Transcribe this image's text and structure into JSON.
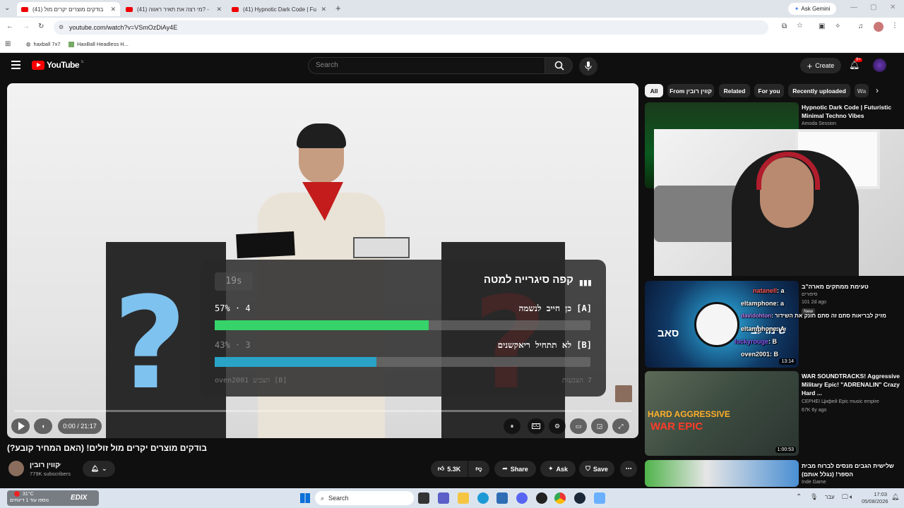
{
  "browser": {
    "tabs": [
      {
        "title": "(41) בודקים מוצרים יקרים מול",
        "active": true
      },
      {
        "title": "(41) מי רצה את תאיר ראווה? -",
        "active": false
      },
      {
        "title": "(41) Hypnotic Dark Code | Futu",
        "active": false
      }
    ],
    "new_tab": "+",
    "ask_gemini": "Ask Gemini",
    "url": "youtube.com/watch?v=VSmOzDiAy4E",
    "bookmarks": [
      "haxball 7x7",
      "HaxBall Headless H..."
    ]
  },
  "youtube": {
    "logo": "YouTube",
    "region": "IL",
    "search_placeholder": "Search",
    "create_label": "Create",
    "notif_count": "9+"
  },
  "video": {
    "poll": {
      "timer": "19s",
      "question": "קפה סיגרייה למטה",
      "options": [
        {
          "label": "[A] כן חייב לנשמה",
          "percent": "57%",
          "votes": "4",
          "fraction": 0.57,
          "color": "#36d36a"
        },
        {
          "label": "[B] לא תתחיל ריאקשנים",
          "percent": "43%",
          "votes": "3",
          "fraction": 0.43,
          "color": "#2aa3c7"
        }
      ],
      "last_vote": "[B] הצביע oven2001",
      "total": "7 הצבעות"
    },
    "time": "0:00 / 21:17",
    "title": "בודקים מוצרים יקרים מול זולים! (האם המחיר קובע?)"
  },
  "channel": {
    "name": "קווין רובין",
    "subscribers": "779K subscribers",
    "likes": "5.3K",
    "share": "Share",
    "ask": "Ask",
    "save": "Save"
  },
  "chips": [
    "All",
    "From קווין רובין",
    "Related",
    "For you",
    "Recently uploaded",
    "Wa"
  ],
  "recommendations": [
    {
      "title": "Hypnotic Dark Code | Futuristic Minimal Techno Vibes",
      "channel": "Amoda Session",
      "meta": ""
    },
    {
      "title": "טעימת ממתקים מארה\"ב",
      "channel": "סיפורים",
      "meta": "101 2d ago",
      "badge": "New"
    },
    {
      "title": "WAR SOUNDTRACKS! Aggressive Military Epic! \"ADRENALIN\" Crazy Hard ...",
      "channel": "СЕРНЕІ Цифей Epic music empire",
      "meta": "67K 6y ago",
      "duration": "1:00:53"
    },
    {
      "title": "שלישית הגבים מנסים לברוח מבית הספר! (נגלל אותם)",
      "channel": "Inde Game",
      "meta": ""
    }
  ],
  "rec2": {
    "duration": "13:14",
    "overlay": "שימו לב",
    "overlay2": "סאב"
  },
  "rec3": {
    "overlay1": "HARD AGGRESSIVE",
    "overlay2": "WAR EPIC"
  },
  "chat": [
    {
      "user": "natanell",
      "msg": ": a",
      "color": "#ff5a5a"
    },
    {
      "user": "eltamphone",
      "msg": ": a",
      "color": "#ffffff"
    },
    {
      "user": "davidohton",
      "msg": ": מזיק לבריאות סתם זה סתם חונק את השידור",
      "color": "#c083ff"
    },
    {
      "user": "eltamphone",
      "msg": ": A",
      "color": "#ffffff"
    },
    {
      "user": "luckyrouge",
      "msg": ": B",
      "color": "#8a5cff"
    },
    {
      "user": "oven2001",
      "msg": ": B",
      "color": "#ffffff"
    }
  ],
  "taskbar": {
    "weather_temp": "31°C",
    "weather_text": "נוספו עוד 1 דיווחים",
    "edix": "EDIX",
    "search": "Search",
    "lang": "עבר",
    "time": "17:03",
    "date": "05/08/2026"
  },
  "colors": {
    "accent": "#ff0000",
    "bg": "#0f0f0f",
    "poll_a": "#36d36a",
    "poll_b": "#2aa3c7"
  }
}
